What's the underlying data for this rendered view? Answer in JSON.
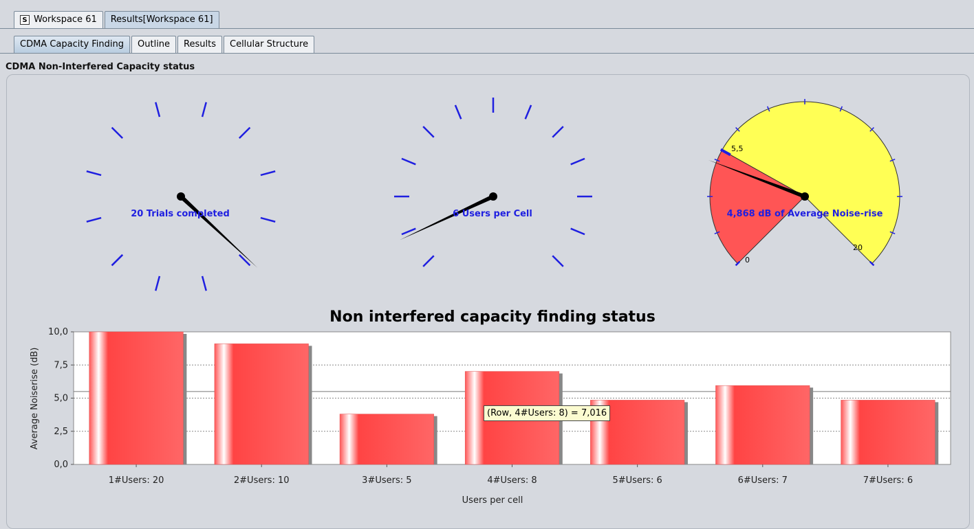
{
  "top_tabs": [
    {
      "label": "Workspace 61",
      "icon": "workspace-icon",
      "active": false
    },
    {
      "label": "Results[Workspace 61]",
      "active": true
    }
  ],
  "sub_tabs": [
    {
      "label": "CDMA Capacity Finding",
      "active": true
    },
    {
      "label": "Outline",
      "active": false
    },
    {
      "label": "Results",
      "active": false
    },
    {
      "label": "Cellular Structure",
      "active": false
    }
  ],
  "panel_title": "CDMA Non-Interfered Capacity status",
  "gauges": {
    "trials": {
      "label": "20 Trials completed"
    },
    "users": {
      "label": "6 Users per Cell"
    },
    "noise": {
      "label": "4,868 dB of Average Noise-rise",
      "min_label": "0",
      "max_label": "20",
      "threshold_label": "5,5",
      "value": 4.868,
      "threshold": 5.5,
      "max": 20
    }
  },
  "chart_data": {
    "type": "bar",
    "title": "Non interfered capacity finding status",
    "xlabel": "Users per cell",
    "ylabel": "Average Noiserise (dB)",
    "categories": [
      "1#Users: 20",
      "2#Users: 10",
      "3#Users: 5",
      "4#Users: 8",
      "5#Users: 6",
      "6#Users: 7",
      "7#Users: 6"
    ],
    "values": [
      10.0,
      9.1,
      3.8,
      7.016,
      4.85,
      5.95,
      4.85
    ],
    "ylim": [
      0,
      10
    ],
    "yticks": [
      "0,0",
      "2,5",
      "5,0",
      "7,5",
      "10,0"
    ],
    "threshold": 5.5,
    "grid": true,
    "bar_color": "#ff5555"
  },
  "tooltip": "(Row, 4#Users: 8) = 7,016",
  "colors": {
    "tick": "#1f1fe0",
    "needle": "#000000",
    "noise_red": "#ff5555",
    "noise_yellow": "#ffff55"
  }
}
